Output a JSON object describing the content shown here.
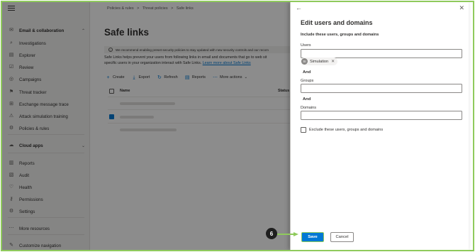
{
  "nav": {
    "items": [
      {
        "label": "Email & collaboration",
        "icon": "mail-icon",
        "glyph": "✉",
        "section": true,
        "chevron": "⌃"
      },
      {
        "label": "Investigations",
        "icon": "investigations-icon",
        "glyph": "⌕"
      },
      {
        "label": "Explorer",
        "icon": "explorer-icon",
        "glyph": "▤"
      },
      {
        "label": "Review",
        "icon": "review-icon",
        "glyph": "☑"
      },
      {
        "label": "Campaigns",
        "icon": "campaigns-icon",
        "glyph": "◎"
      },
      {
        "label": "Threat tracker",
        "icon": "threat-tracker-icon",
        "glyph": "⚑"
      },
      {
        "label": "Exchange message trace",
        "icon": "exchange-icon",
        "glyph": "⊞"
      },
      {
        "label": "Attack simulation training",
        "icon": "attack-simulation-icon",
        "glyph": "⚠"
      },
      {
        "label": "Policies & rules",
        "icon": "policies-icon",
        "glyph": "⚙"
      },
      {
        "label": "Cloud apps",
        "icon": "cloud-apps-icon",
        "glyph": "☁",
        "section": true,
        "chevron": "⌄"
      },
      {
        "label": "Reports",
        "icon": "reports-icon",
        "glyph": "▥"
      },
      {
        "label": "Audit",
        "icon": "audit-icon",
        "glyph": "▧"
      },
      {
        "label": "Health",
        "icon": "health-icon",
        "glyph": "♡"
      },
      {
        "label": "Permissions",
        "icon": "permissions-icon",
        "glyph": "⚷"
      },
      {
        "label": "Settings",
        "icon": "settings-icon",
        "glyph": "⚙"
      },
      {
        "label": "More resources",
        "icon": "more-resources-icon",
        "glyph": "⋯"
      },
      {
        "label": "Customize navigation",
        "icon": "customize-icon",
        "glyph": "✎"
      }
    ]
  },
  "breadcrumb": {
    "items": [
      "Policies & rules",
      ">",
      "Threat policies",
      ">",
      "Safe links"
    ]
  },
  "page": {
    "title": "Safe links",
    "info": "We recommend enabling preset security policies to stay updated with new security controls and our recom",
    "description": "Safe Links helps prevent your users from following links in email and documents that go to web sit",
    "description2": "specific users in your organization interact with Safe Links.",
    "learn_more": "Learn more about Safe Links"
  },
  "commands": [
    {
      "label": "Create",
      "icon": "plus-icon",
      "glyph": "+"
    },
    {
      "label": "Export",
      "icon": "export-icon",
      "glyph": "⤓"
    },
    {
      "label": "Refresh",
      "icon": "refresh-icon",
      "glyph": "↻"
    },
    {
      "label": "Reports",
      "icon": "report-icon",
      "glyph": "▤"
    },
    {
      "label": "More actions",
      "icon": "more-icon",
      "glyph": "⋯",
      "chevron": "⌄"
    }
  ],
  "table": {
    "col_name": "Name",
    "col_status": "Status"
  },
  "panel": {
    "back_glyph": "←",
    "close_glyph": "✕",
    "title": "Edit users and domains",
    "subtitle": "Include these users, groups and domains",
    "users_label": "Users",
    "user_pill": {
      "initials": "SI",
      "name": "Simulation",
      "remove": "✕"
    },
    "and1": "And",
    "groups_label": "Groups",
    "and2": "And",
    "domains_label": "Domains",
    "exclude_label": "Exclude these users, groups and domains",
    "save_label": "Save",
    "cancel_label": "Cancel"
  },
  "annotation": {
    "step": "6"
  },
  "colors": {
    "accent": "#0078d4",
    "highlight": "#8fca5c",
    "overlay": "#000000"
  }
}
